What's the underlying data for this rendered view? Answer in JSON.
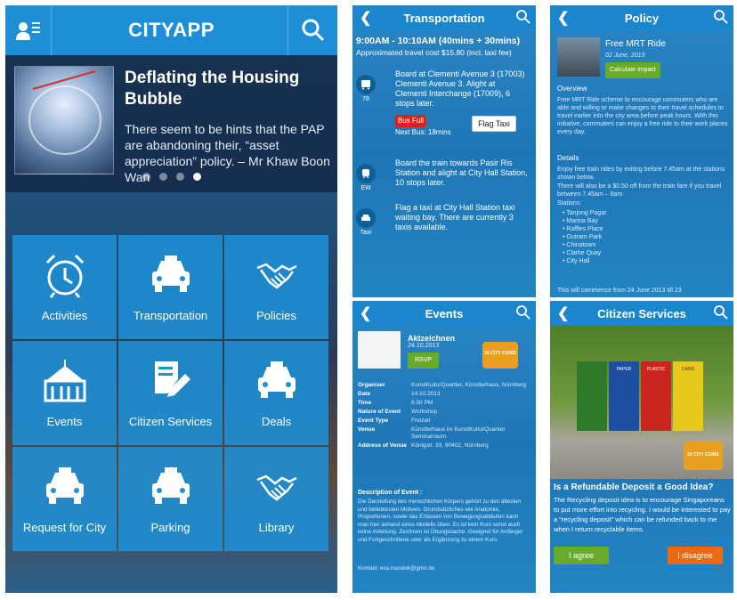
{
  "main": {
    "title": "CITYAPP",
    "banner": {
      "title": "Deflating the Housing Bubble",
      "text": "There seem to be hints that the PAP are abandoning their, “asset appreciation” policy. – Mr Khaw Boon Wan",
      "page_count": 4,
      "active_page": 4
    },
    "tiles": [
      {
        "label": "Activities",
        "icon": "alarm-clock-icon"
      },
      {
        "label": "Transportation",
        "icon": "taxi-icon"
      },
      {
        "label": "Policies",
        "icon": "handshake-icon"
      },
      {
        "label": "Events",
        "icon": "tent-icon"
      },
      {
        "label": "Citizen Services",
        "icon": "form-pencil-icon"
      },
      {
        "label": "Deals",
        "icon": "taxi-icon"
      },
      {
        "label": "Request for City",
        "icon": "taxi-icon"
      },
      {
        "label": "Parking",
        "icon": "taxi-icon"
      },
      {
        "label": "Library",
        "icon": "handshake-icon"
      }
    ]
  },
  "transport": {
    "title": "Transportation",
    "time": "9:00AM - 10:10AM (40mins + 30mins)",
    "cost": "Approximated travel cost $15.80 (incl. taxi fee)",
    "steps": [
      {
        "code": "78",
        "text": "Board at Clementi Avenue 3 (17003) Clementi Avenue 3. Alight at Clementi Interchange (17009), 6 stops later."
      },
      {
        "code": "EW",
        "text": "Board the train towards Pasir Ris Station and alight at City Hall Station, 10 stops later."
      },
      {
        "code": "Taxi",
        "text": "Flag a taxi at City Hall Station taxi waiting bay. There are currently 3 taxis available."
      }
    ],
    "bus_full": "Bus Full",
    "next_bus": "Next Bus: 18mins",
    "flag_taxi": "Flag Taxi"
  },
  "policy": {
    "title": "Policy",
    "item_title": "Free MRT Ride",
    "date": "02 June, 2013",
    "calc": "Calculate impact",
    "overview_h": "Overview",
    "overview": "Free MRT Ride scheme to encourage commuters who are able and willing to make changes to their travel schedules to travel earlier into the city area before peak hours. With this initiative, commuters can enjoy a free ride to their work places every day.",
    "details_h": "Details",
    "details1": "Enjoy free train rides by exiting before 7.45am at the stations shown below.",
    "details2": "There will also be a $0.50 off from the train fare if you travel between 7.45am – 8am",
    "stations_h": "Stations:",
    "stations": [
      "Tanjong Pagar",
      "Marina Bay",
      "Raffles Place",
      "Outram Park",
      "Chinatown",
      "Clarke Quay",
      "City Hall"
    ],
    "more": "This will commence from 24 June 2013 till 23"
  },
  "events": {
    "title": "Events",
    "name": "Aktzeichnen",
    "date": "24.10.2013",
    "rsvp": "RSVP",
    "badge": "10 CITY COINS",
    "fields": [
      {
        "k": "Organiser",
        "v": "KunstKulturQuartier, Künstlerhaus, Nürnberg"
      },
      {
        "k": "Date",
        "v": "14.10.2013"
      },
      {
        "k": "Time",
        "v": "6.00 PM"
      },
      {
        "k": "Nature of Event",
        "v": "Workshop"
      },
      {
        "k": "Event Type",
        "v": "Freizeit"
      },
      {
        "k": "Venue",
        "v": "Künstlerhaus im KunstKulturQuartier Seminarraum"
      },
      {
        "k": "Address of Venue",
        "v": "Königstr. 93, 90402, Nürnberg"
      }
    ],
    "desc_h": "Description of Event :",
    "desc": "Die Darstellung des menschlichen Körpers gehört zu den ältesten und beliebtesten Motiven. Grundsätzliches wie Anatomie, Proportionen, sowie das Erfassen von Bewegungsabläufen kann man hier anhand eines Modells üben. Es ist kein Kurs sonst auch keine Anleitung. Zeichnen ist Übungssache. Geeignet für Anfänger und Fortgeschrittene oder als Ergänzung zu einem Kurs.",
    "contact": "Kontakt: eva.mandok@gmx.de"
  },
  "citizen": {
    "title": "Citizen Services",
    "bins": [
      "PAPER",
      "PLASTIC",
      "CANS"
    ],
    "badge": "10 CITY COINS",
    "question": "Is a Refundable Deposit a Good Idea?",
    "text": "The Recycling deposit idea is to encourage Singaporeans to put more effort into recycling. I would be interested to pay a “recycling deposit” which can be refunded back to me when I return recyclable items.",
    "agree": "I agree",
    "disagree": "I disagree"
  }
}
